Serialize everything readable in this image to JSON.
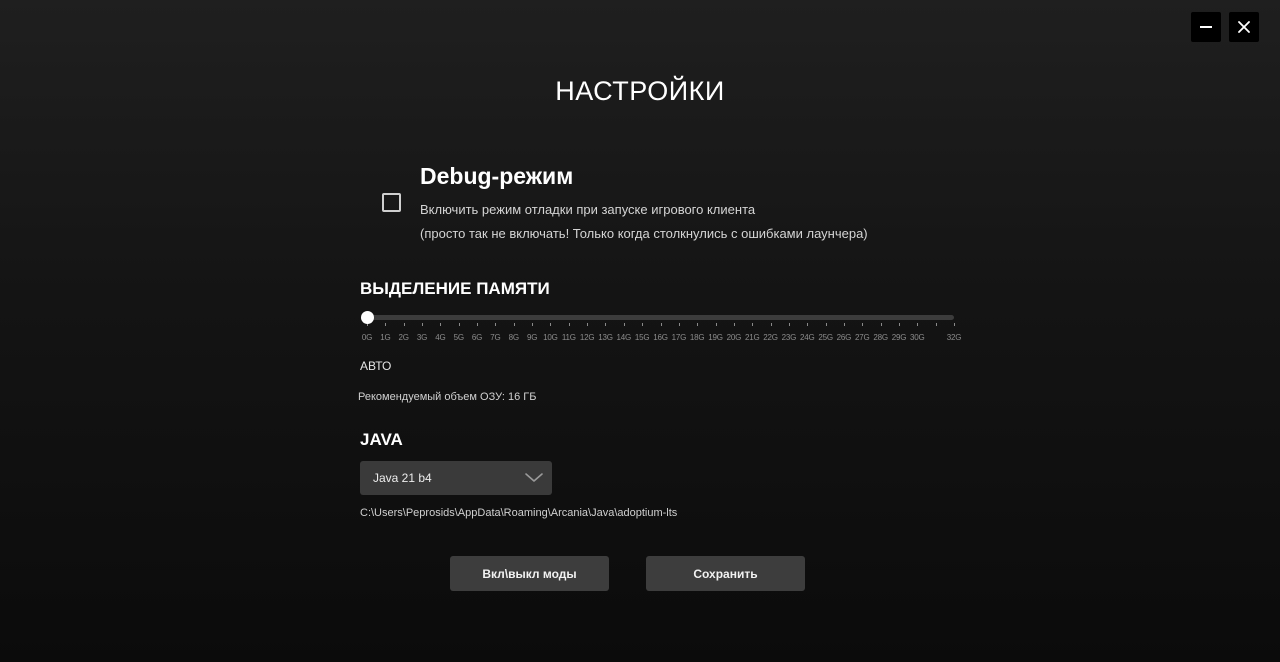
{
  "window_controls": {
    "minimize_icon": "minimize-icon",
    "close_icon": "close-icon",
    "close_glyph": "✕"
  },
  "page": {
    "title": "НАСТРОЙКИ"
  },
  "debug": {
    "checked": false,
    "title": "Debug-режим",
    "description_line1": "Включить режим отладки при запуске игрового клиента",
    "description_line2": "(просто так не включать! Только когда столкнулись с ошибками лаунчера)"
  },
  "memory": {
    "title": "ВЫДЕЛЕНИЕ ПАМЯТИ",
    "value_gb": 0,
    "min_gb": 0,
    "max_gb": 32,
    "tick_labels": [
      "0G",
      "1G",
      "2G",
      "3G",
      "4G",
      "5G",
      "6G",
      "7G",
      "8G",
      "9G",
      "10G",
      "11G",
      "12G",
      "13G",
      "14G",
      "15G",
      "16G",
      "17G",
      "18G",
      "19G",
      "20G",
      "21G",
      "22G",
      "23G",
      "24G",
      "25G",
      "26G",
      "27G",
      "28G",
      "29G",
      "30G",
      "32G"
    ],
    "current_label": "АВТО",
    "recommended": "Рекомендуемый объем ОЗУ: 16 ГБ"
  },
  "java": {
    "title": "JAVA",
    "selected": "Java 21 b4",
    "path": "C:\\Users\\Peprosids\\AppData\\Roaming\\Arcania\\Java\\adoptium-lts"
  },
  "buttons": {
    "mods_label": "Вкл\\выкл моды",
    "save_label": "Сохранить"
  },
  "colors": {
    "background": "#141414",
    "button": "#3d3d3d",
    "slider_track": "#3c3c3c",
    "text": "#ffffff"
  }
}
